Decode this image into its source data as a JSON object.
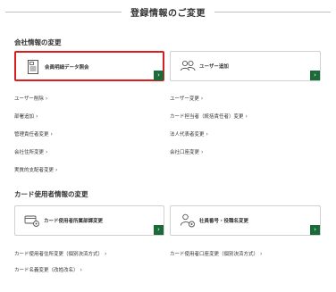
{
  "page": {
    "title": "登録情報のご変更"
  },
  "company_section": {
    "heading": "会社情報の変更",
    "cards": [
      {
        "label": "会員明細データ照会",
        "icon": "document-icon"
      },
      {
        "label": "ユーザー追加",
        "icon": "users-icon"
      }
    ],
    "links_left": [
      "ユーザー削除",
      "部署追加",
      "管理責任者変更",
      "会社住所変更",
      "実質的支配者変更"
    ],
    "links_right": [
      "ユーザー変更",
      "カード担当者（統括責任者）変更",
      "法人代表者変更",
      "会社口座変更"
    ]
  },
  "card_section": {
    "heading": "カード使用者情報の変更",
    "cards": [
      {
        "label": "カード使用者所属部課変更",
        "icon": "card-gear-icon"
      },
      {
        "label": "社員番号・役職名変更",
        "icon": "user-gear-icon"
      }
    ],
    "links_left": [
      "カード使用者住所変更（個別決済方式）",
      "カード名義変更（改姓改名）"
    ],
    "links_right": [
      "カード使用者口座変更（個別決済方式）"
    ]
  },
  "colors": {
    "accent_green": "#1b6b3a",
    "highlight_red": "#d81e1e",
    "border_gray": "#d0d0d0"
  },
  "arrow_glyph": "›",
  "chevron_glyph": "›"
}
